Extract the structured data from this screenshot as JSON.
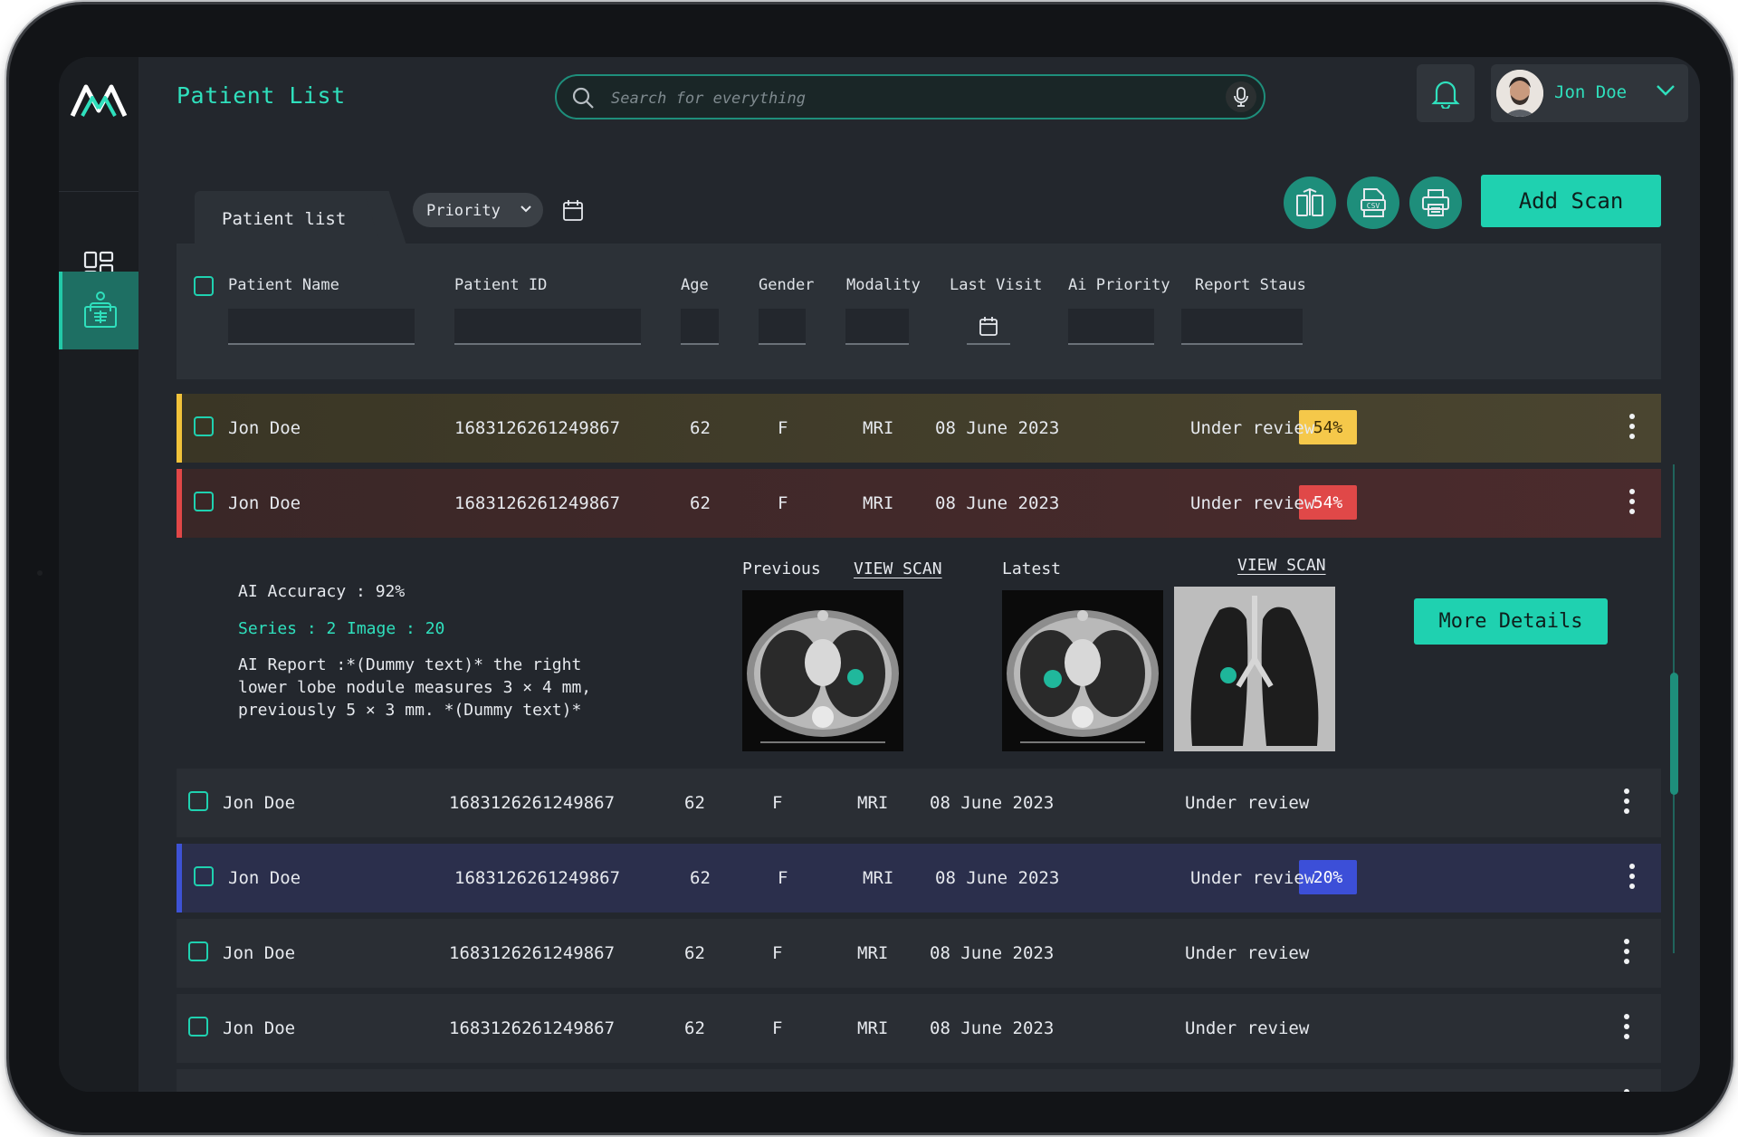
{
  "app": {
    "page_title": "Patient List",
    "search": {
      "placeholder": "Search for everything"
    },
    "user": {
      "name": "Jon Doe"
    }
  },
  "toolbar": {
    "tab_label": "Patient list",
    "filter_label": "Priority",
    "add_scan_label": "Add Scan",
    "actions": [
      "compare-icon",
      "csv-icon",
      "printer-icon"
    ]
  },
  "table": {
    "headers": {
      "name": "Patient Name",
      "id": "Patient ID",
      "age": "Age",
      "gender": "Gender",
      "modality": "Modality",
      "last_visit": "Last Visit",
      "ai_priority": "Ai Priority",
      "report_status": "Report Staus"
    },
    "rows": [
      {
        "name": "Jon Doe",
        "id": "1683126261249867",
        "age": "62",
        "gender": "F",
        "modality": "MRI",
        "last_visit": "08 June 2023",
        "priority": "54%",
        "status": "Under review"
      },
      {
        "name": "Jon Doe",
        "id": "1683126261249867",
        "age": "62",
        "gender": "F",
        "modality": "MRI",
        "last_visit": "08 June 2023",
        "priority": "54%",
        "status": "Under review"
      },
      {
        "name": "Jon Doe",
        "id": "1683126261249867",
        "age": "62",
        "gender": "F",
        "modality": "MRI",
        "last_visit": "08 June 2023",
        "priority": "",
        "status": "Under review"
      },
      {
        "name": "Jon Doe",
        "id": "1683126261249867",
        "age": "62",
        "gender": "F",
        "modality": "MRI",
        "last_visit": "08 June 2023",
        "priority": "20%",
        "status": "Under review"
      },
      {
        "name": "Jon Doe",
        "id": "1683126261249867",
        "age": "62",
        "gender": "F",
        "modality": "MRI",
        "last_visit": "08 June 2023",
        "priority": "",
        "status": "Under review"
      },
      {
        "name": "Jon Doe",
        "id": "1683126261249867",
        "age": "62",
        "gender": "F",
        "modality": "MRI",
        "last_visit": "08 June 2023",
        "priority": "",
        "status": "Under review"
      }
    ]
  },
  "details": {
    "ai_accuracy": "AI Accuracy : 92%",
    "series": "Series : 2",
    "image": "Image : 20",
    "report": "AI Report :*(Dummy text)* the right lower lobe nodule measures 3 × 4 mm, previously 5 × 3 mm. *(Dummy text)*",
    "previous_label": "Previous",
    "latest_label": "Latest",
    "view_scan_label": "VIEW SCAN",
    "more_details_label": "More Details"
  },
  "colors": {
    "accent": "#1fd1b0",
    "priority_high": "#f5c84a",
    "priority_critical": "#e04848",
    "priority_low": "#3c4fd8"
  }
}
